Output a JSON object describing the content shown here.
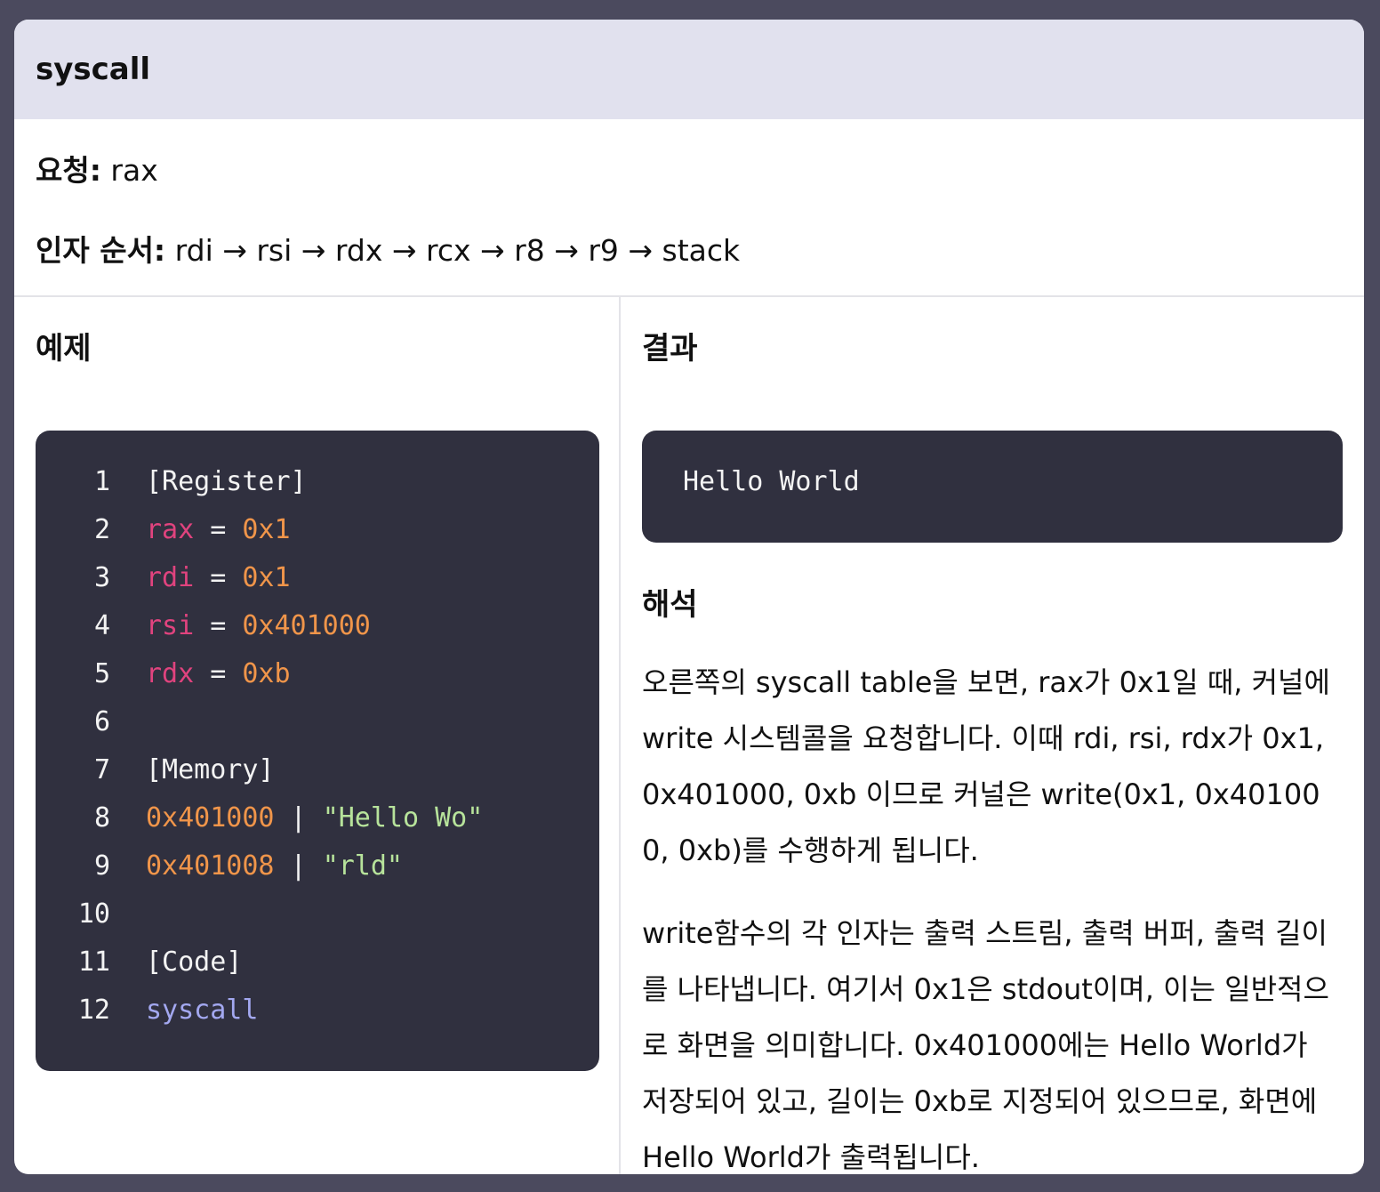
{
  "header": {
    "title": "syscall"
  },
  "info": {
    "request_label": "요청:",
    "request_value": " rax",
    "args_label": "인자 순서:",
    "args_value": " rdi → rsi → rdx → rcx → r8 → r9 → stack"
  },
  "example": {
    "title": "예제",
    "lines": [
      {
        "n": "1",
        "tokens": [
          {
            "t": "[Register]",
            "c": "plain"
          }
        ]
      },
      {
        "n": "2",
        "tokens": [
          {
            "t": "rax",
            "c": "reg"
          },
          {
            "t": " = ",
            "c": "plain"
          },
          {
            "t": "0x1",
            "c": "num"
          }
        ]
      },
      {
        "n": "3",
        "tokens": [
          {
            "t": "rdi",
            "c": "reg"
          },
          {
            "t": " = ",
            "c": "plain"
          },
          {
            "t": "0x1",
            "c": "num"
          }
        ]
      },
      {
        "n": "4",
        "tokens": [
          {
            "t": "rsi",
            "c": "reg"
          },
          {
            "t": " = ",
            "c": "plain"
          },
          {
            "t": "0x401000",
            "c": "num"
          }
        ]
      },
      {
        "n": "5",
        "tokens": [
          {
            "t": "rdx",
            "c": "reg"
          },
          {
            "t": " = ",
            "c": "plain"
          },
          {
            "t": "0xb",
            "c": "num"
          }
        ]
      },
      {
        "n": "6",
        "tokens": []
      },
      {
        "n": "7",
        "tokens": [
          {
            "t": "[Memory]",
            "c": "plain"
          }
        ]
      },
      {
        "n": "8",
        "tokens": [
          {
            "t": "0x401000",
            "c": "num"
          },
          {
            "t": " | ",
            "c": "plain"
          },
          {
            "t": "\"Hello Wo\"",
            "c": "str"
          }
        ]
      },
      {
        "n": "9",
        "tokens": [
          {
            "t": "0x401008",
            "c": "num"
          },
          {
            "t": " | ",
            "c": "plain"
          },
          {
            "t": "\"rld\"",
            "c": "str"
          }
        ]
      },
      {
        "n": "10",
        "tokens": []
      },
      {
        "n": "11",
        "tokens": [
          {
            "t": "[Code]",
            "c": "plain"
          }
        ]
      },
      {
        "n": "12",
        "tokens": [
          {
            "t": "syscall",
            "c": "fn"
          }
        ]
      }
    ]
  },
  "result": {
    "title": "결과",
    "output": "Hello World"
  },
  "interpretation": {
    "title": "해석",
    "paragraphs": [
      "오른쪽의 syscall table을 보면, rax가 0x1일 때, 커널에 write 시스템콜을 요청합니다. 이때 rdi, rsi, rdx가 0x1, 0x401000, 0xb 이므로 커널은 write(0x1, 0x401000, 0xb)를 수행하게 됩니다.",
      "write함수의 각 인자는 출력 스트림, 출력 버퍼, 출력 길이를 나타냅니다. 여기서 0x1은 stdout이며, 이는 일반적으로 화면을 의미합니다. 0x401000에는 Hello World가 저장되어 있고, 길이는 0xb로 지정되어 있으므로, 화면에 Hello World가 출력됩니다."
    ]
  },
  "colors": {
    "page_bg": "#4b4a5e",
    "header_bg": "#e1e1ee",
    "code_bg": "#30303f",
    "register": "#e0437e",
    "number": "#f0954a",
    "string": "#b7e39b",
    "keyword": "#a3a8f0"
  }
}
